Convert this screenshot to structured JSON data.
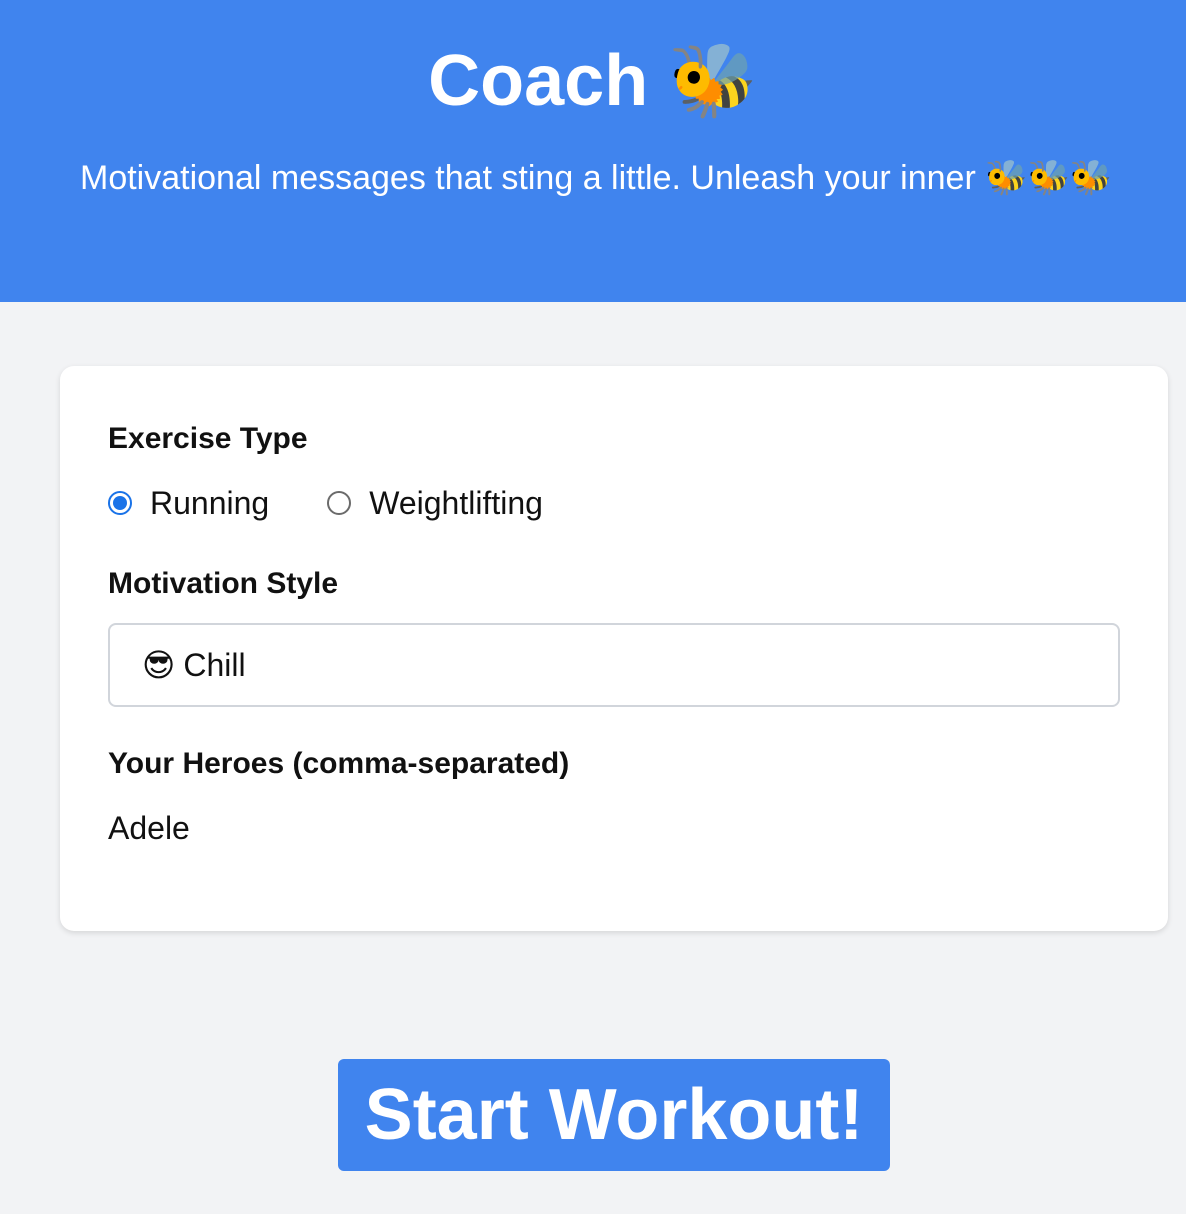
{
  "header": {
    "title": "Coach",
    "title_emoji": "🐝",
    "tagline": "Motivational messages that sting a little. Unleash your inner",
    "tagline_emoji": "🐝🐝🐝",
    "background_color": "#4084ee"
  },
  "form": {
    "exercise_type": {
      "label": "Exercise Type",
      "options": [
        {
          "label": "Running",
          "checked": true
        },
        {
          "label": "Weightlifting",
          "checked": false
        }
      ]
    },
    "motivation_style": {
      "label": "Motivation Style",
      "selected_icon": "😎",
      "selected_value": "Chill"
    },
    "heroes": {
      "label": "Your Heroes (comma-separated)",
      "value": "Adele"
    }
  },
  "actions": {
    "start_label": "Start Workout!"
  },
  "colors": {
    "accent": "#4084ee",
    "radio_checked": "#1a73e8",
    "page_background": "#f2f3f5"
  }
}
